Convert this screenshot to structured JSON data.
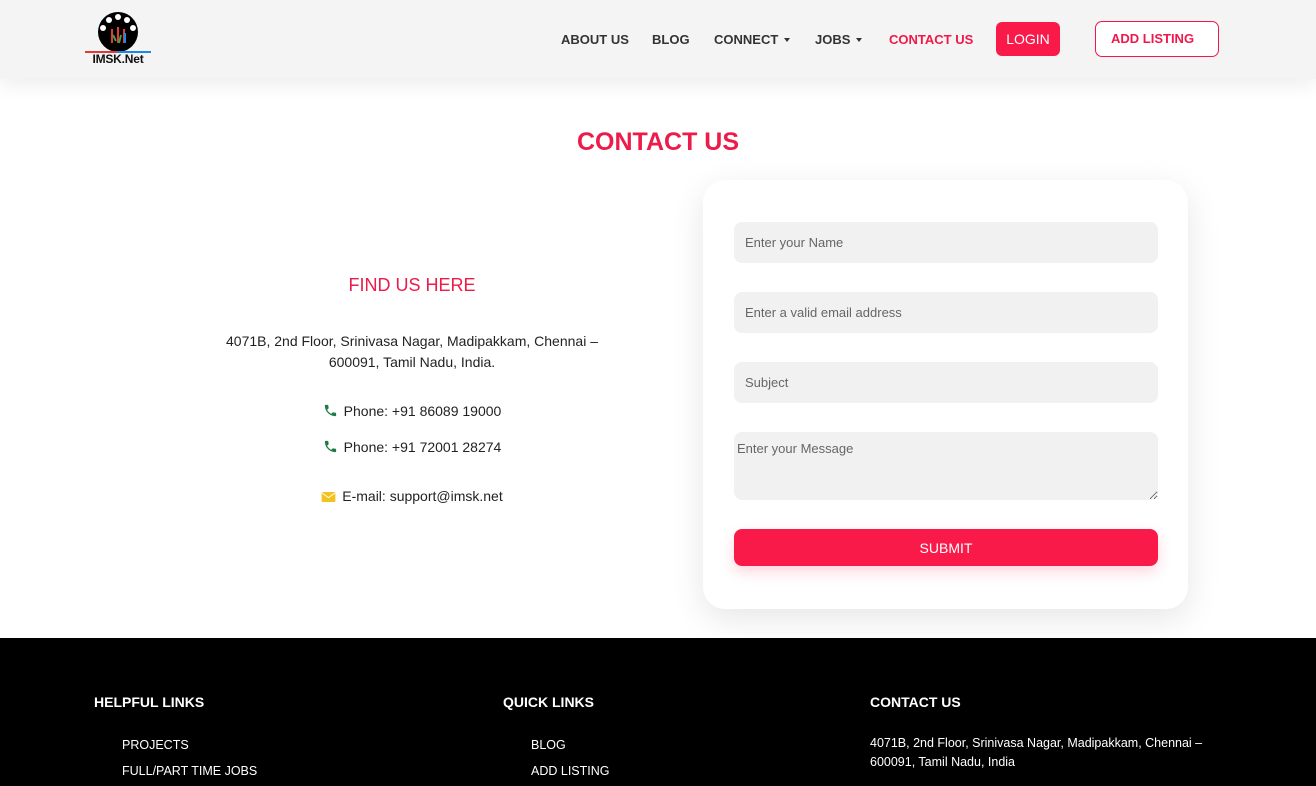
{
  "brand": {
    "name": "IMSK.Net"
  },
  "nav": {
    "items": [
      {
        "label": "ABOUT US"
      },
      {
        "label": "BLOG"
      },
      {
        "label": "CONNECT"
      },
      {
        "label": "JOBS"
      },
      {
        "label": "CONTACT US"
      }
    ],
    "login_label": "LOGIN",
    "add_listing_label": "ADD LISTING"
  },
  "main": {
    "title": "CONTACT US",
    "find_title": "FIND US HERE",
    "address": "4071B, 2nd Floor, Srinivasa Nagar, Madipakkam, Chennai – 600091, Tamil Nadu, India.",
    "phone1": "Phone: +91 86089 19000",
    "phone2": "Phone: +91 72001 28274",
    "email": "E-mail: support@imsk.net"
  },
  "form": {
    "name_placeholder": "Enter your Name",
    "email_placeholder": "Enter a valid email address",
    "subject_placeholder": "Subject",
    "message_placeholder": "Enter your Message",
    "submit_label": "SUBMIT"
  },
  "footer": {
    "helpful_title": "HELPFUL LINKS",
    "helpful_links": [
      "PROJECTS",
      "FULL/PART TIME JOBS"
    ],
    "quick_title": "QUICK LINKS",
    "quick_links": [
      "BLOG",
      "ADD LISTING"
    ],
    "contact_title": "CONTACT US",
    "contact_address": "4071B, 2nd Floor, Srinivasa Nagar, Madipakkam, Chennai – 600091, Tamil Nadu, India"
  },
  "colors": {
    "accent": "#f0184a",
    "footer_bg": "#000000",
    "header_bg": "#f4f4f4"
  },
  "icons": [
    "phone-icon",
    "mail-icon"
  ]
}
